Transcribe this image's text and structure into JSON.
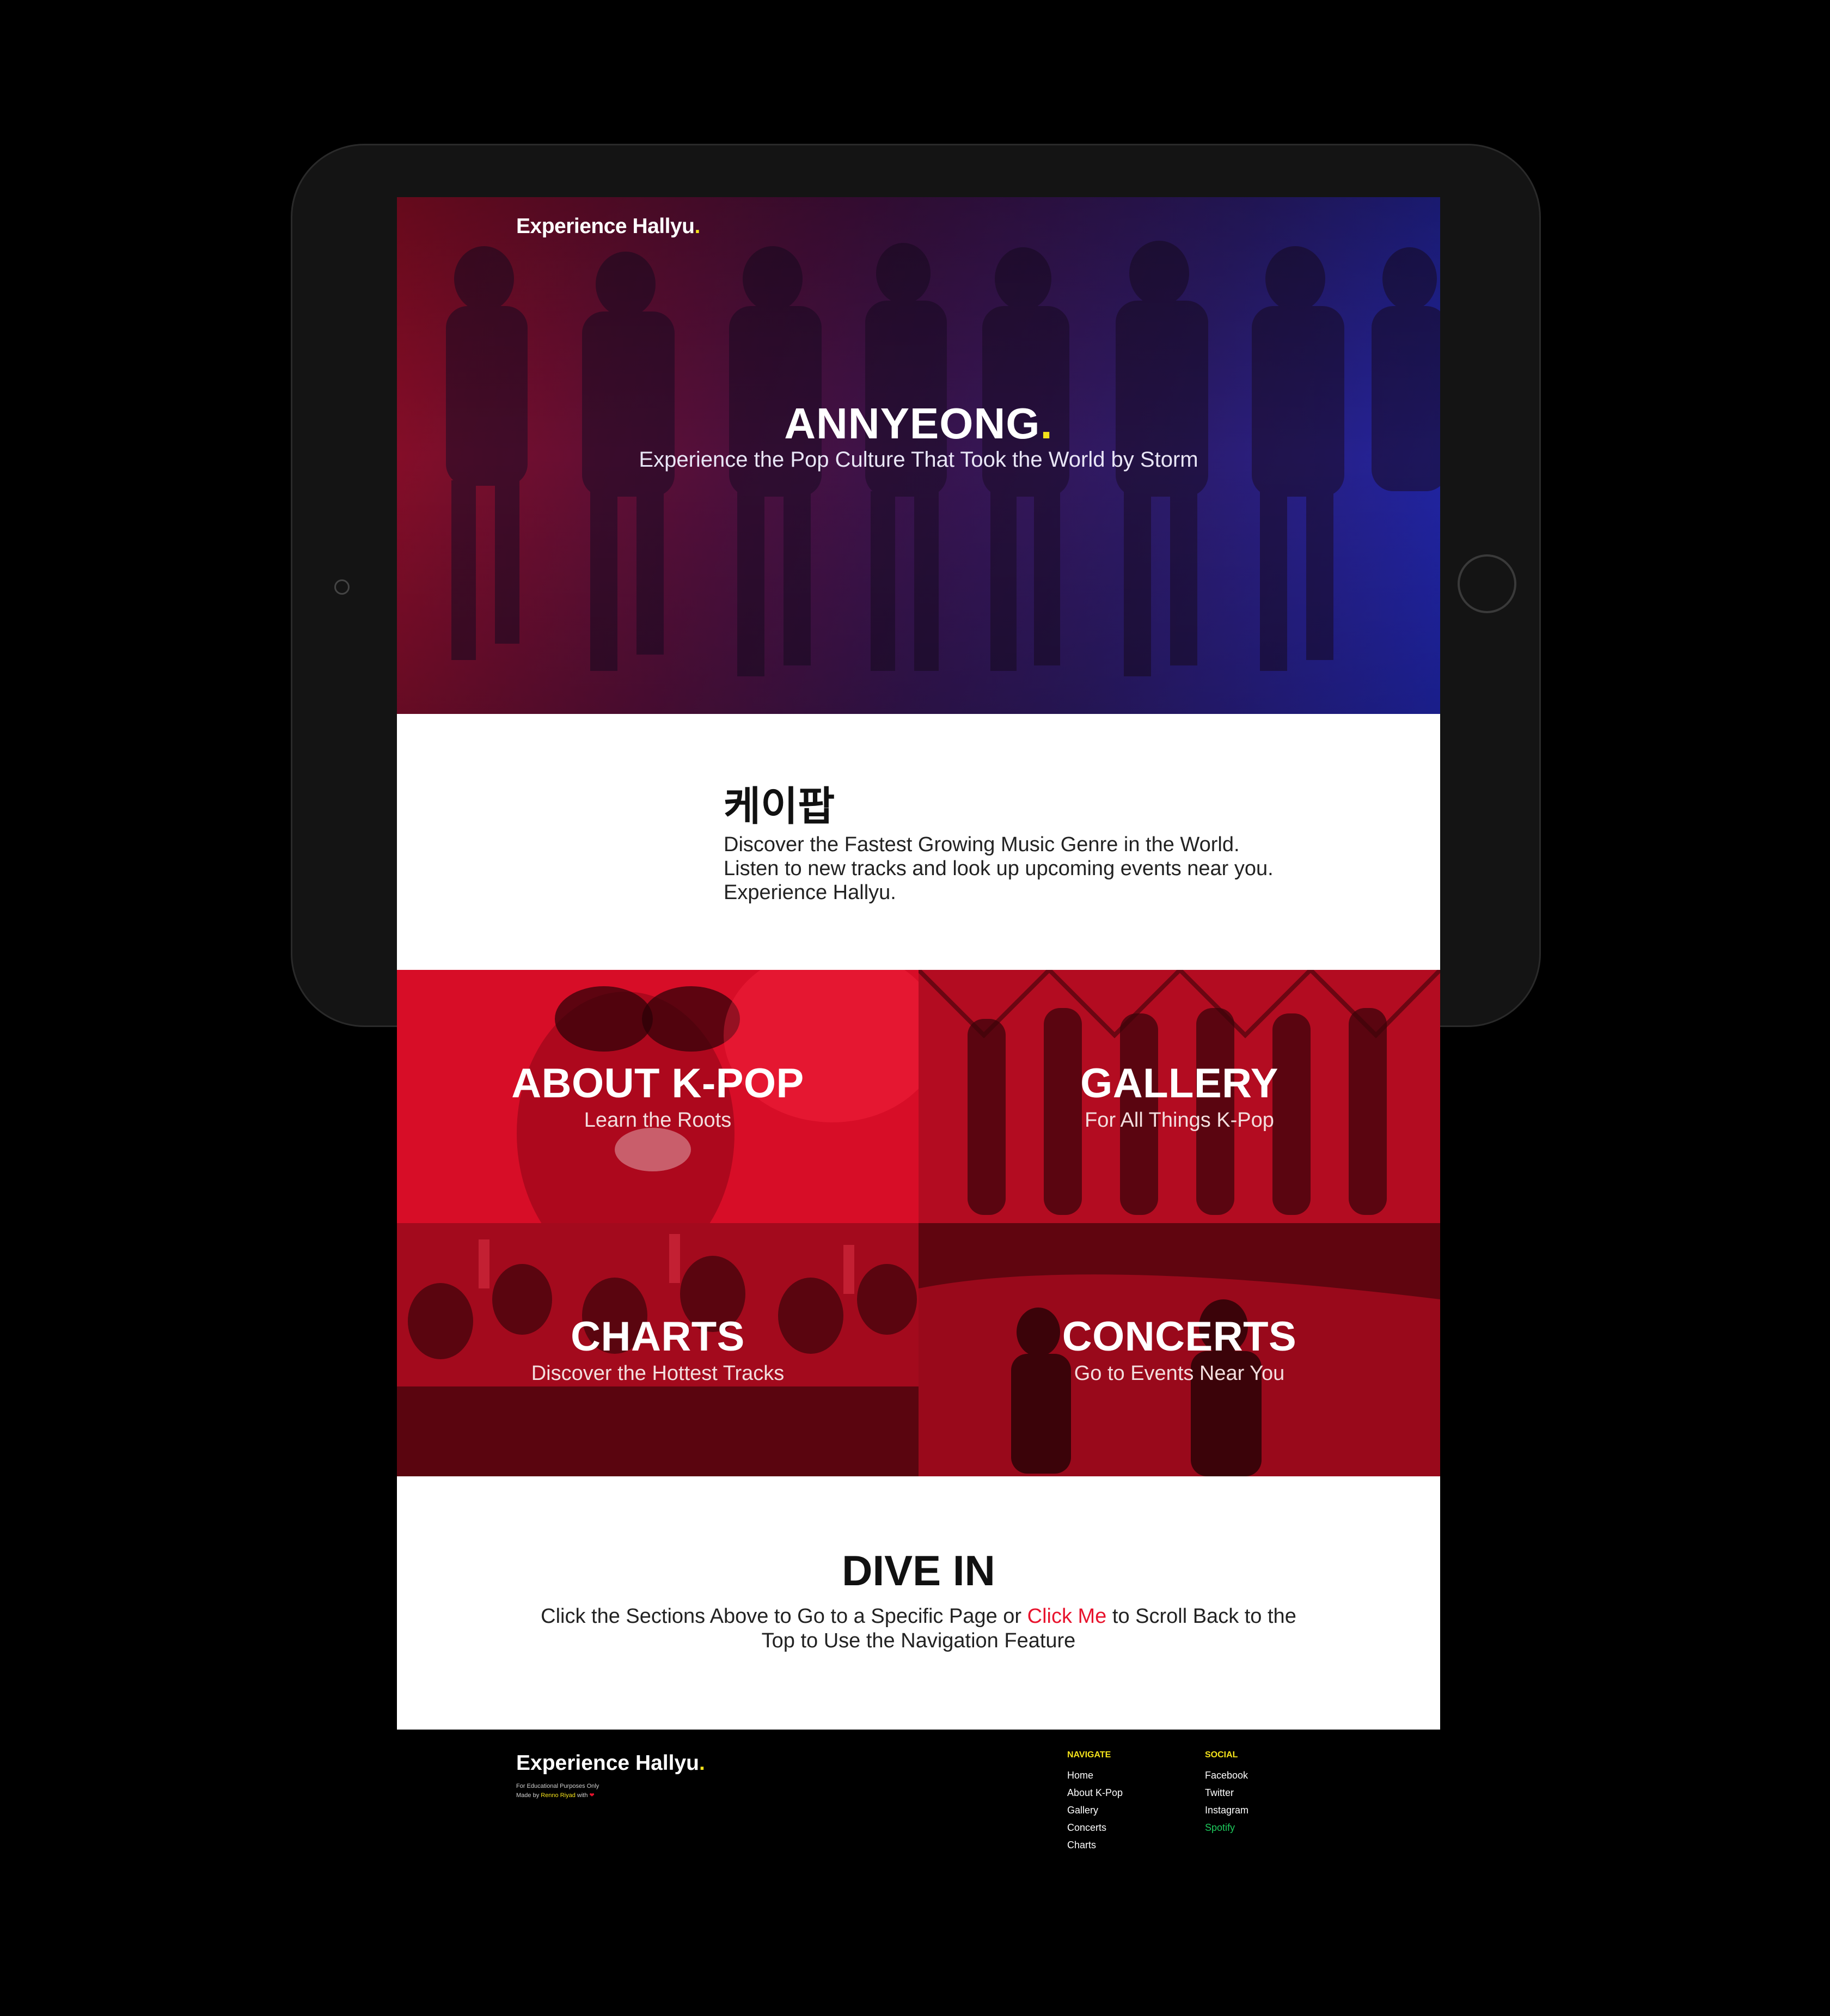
{
  "brand": {
    "name": "Experience Hallyu",
    "dot": "."
  },
  "hero": {
    "title": "ANNYEONG",
    "title_dot": ".",
    "subtitle": "Experience the Pop Culture That Took the World by Storm"
  },
  "intro": {
    "heading": "케이팝",
    "lines": [
      "Discover the Fastest Growing Music Genre in the World.",
      "Listen to new tracks and look up upcoming events near you.",
      "Experience Hallyu."
    ]
  },
  "tiles": [
    {
      "title": "ABOUT K-POP",
      "subtitle": "Learn the Roots"
    },
    {
      "title": "GALLERY",
      "subtitle": "For All Things K-Pop"
    },
    {
      "title": "CHARTS",
      "subtitle": "Discover the Hottest Tracks"
    },
    {
      "title": "CONCERTS",
      "subtitle": "Go to Events Near You"
    }
  ],
  "dive": {
    "title": "DIVE IN",
    "text_before": "Click the Sections Above to Go to a Specific Page or ",
    "link": "Click Me",
    "text_after": " to Scroll Back to the Top to Use the Navigation Feature"
  },
  "footer": {
    "logo": "Experience Hallyu",
    "logo_dot": ".",
    "note": "For Educational Purposes Only",
    "made_prefix": "Made by ",
    "made_author": "Renno Riyad",
    "made_suffix": " with ",
    "heart": "❤",
    "navigate": {
      "heading": "NAVIGATE",
      "links": [
        "Home",
        "About K-Pop",
        "Gallery",
        "Concerts",
        "Charts"
      ]
    },
    "social": {
      "heading": "SOCIAL",
      "links": [
        "Facebook",
        "Twitter",
        "Instagram",
        "Spotify"
      ]
    }
  },
  "colors": {
    "accent_red": "#e8132d",
    "accent_yellow": "#f4e21b",
    "spotify_green": "#1ec95c",
    "hero_left": "#5a0a1e",
    "hero_right": "#1f22a6"
  }
}
